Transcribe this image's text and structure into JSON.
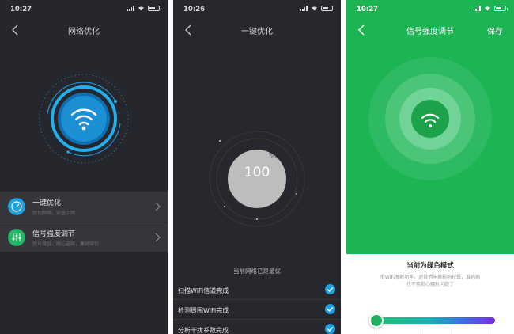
{
  "screens": [
    {
      "status_time": "10:27",
      "title": "网络优化",
      "menu": [
        {
          "title": "一键优化",
          "subtitle": "优化网络，安全上网"
        },
        {
          "title": "信号强度调节",
          "subtitle": "信号增益，随心选择，兼顾穿衍"
        }
      ]
    },
    {
      "status_time": "10:26",
      "title": "一键优化",
      "progress_value": "100",
      "progress_unit": "%",
      "state_text": "当前网络已是最优",
      "tasks": [
        {
          "label": "扫描WiFi信道完成",
          "done": true
        },
        {
          "label": "检测周围WiFi完成",
          "done": true
        },
        {
          "label": "分析干扰系数完成",
          "done": true
        }
      ]
    },
    {
      "status_time": "10:27",
      "title": "信号强度调节",
      "action": "保存",
      "mode_title": "当前为绿色模式",
      "mode_desc": "低WiFi发射功率，对其他电器影响较低，准妈妈也不用担心辐射问题了",
      "slider_level": 0.0
    }
  ],
  "colors": {
    "accent_blue": "#1aa0e6",
    "brand_green": "#1db454",
    "dark_bg": "#26272c"
  },
  "icons": {
    "back": "chevron-left-icon",
    "wifi": "wifi-icon",
    "check": "check-circle-icon"
  }
}
